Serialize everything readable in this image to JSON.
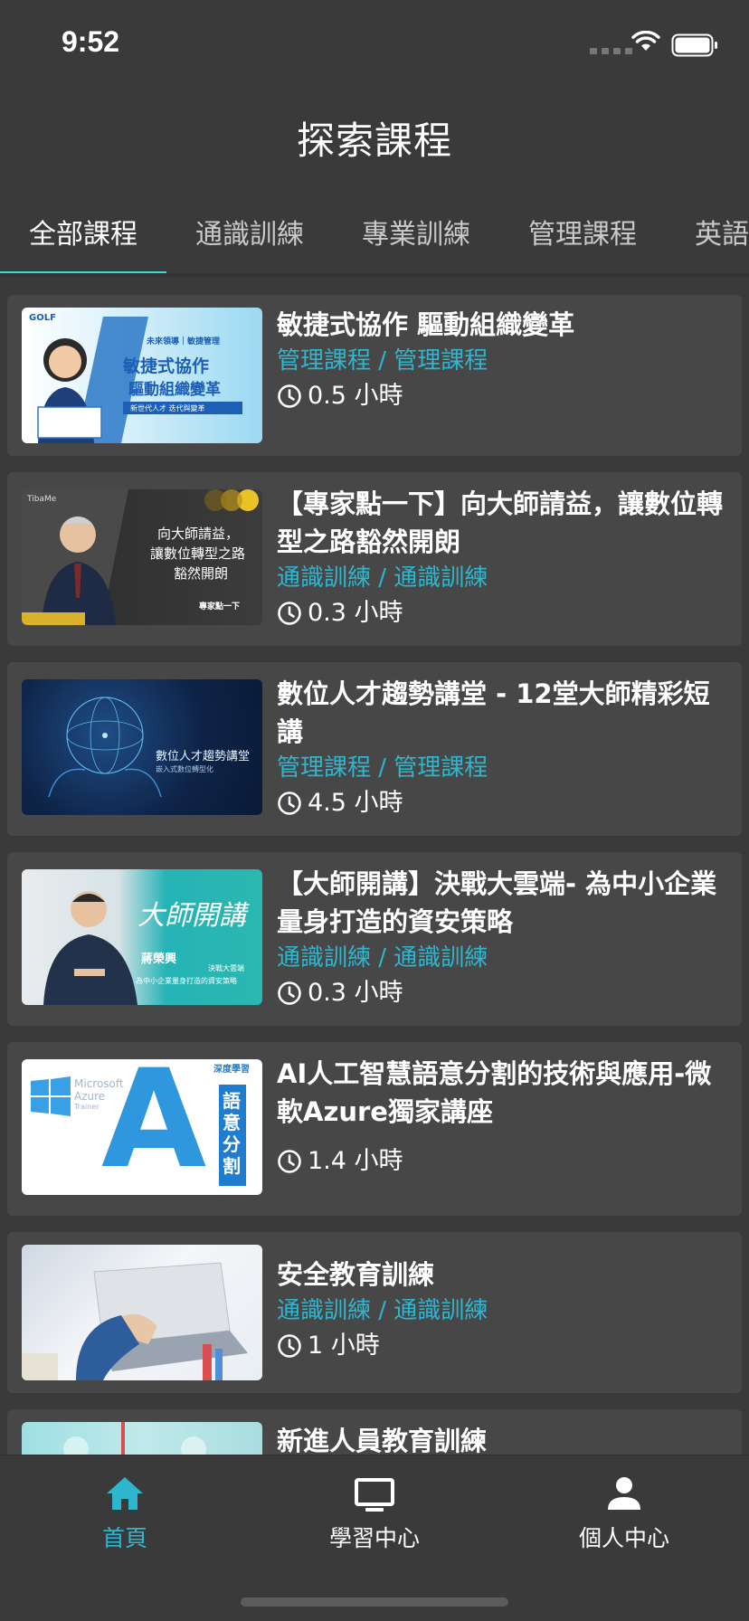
{
  "status": {
    "time": "9:52"
  },
  "header": {
    "title": "探索課程"
  },
  "tabs": [
    {
      "label": "全部課程",
      "active": true
    },
    {
      "label": "通識訓練"
    },
    {
      "label": "專業訓練"
    },
    {
      "label": "管理課程"
    },
    {
      "label": "英語"
    }
  ],
  "courses": [
    {
      "title": "敏捷式協作 驅動組織變革",
      "category": "管理課程 / 管理課程",
      "duration": "0.5 小時",
      "thumb_text": {
        "tag": "未來領導｜敏捷管理",
        "brand": "GOLF",
        "line1": "敏捷式協作",
        "line2": "驅動組織變革",
        "banner": "新世代人才 迭代與變革"
      }
    },
    {
      "title": "【專家點一下】向大師請益，讓數位轉型之路豁然開朗",
      "category": "通識訓練 / 通識訓練",
      "duration": "0.3 小時",
      "thumb_text": {
        "brand": "TibaMe",
        "line1": "向大師請益，",
        "line2": "讓數位轉型之路",
        "line3": "豁然開朗",
        "badge": "專家點一下"
      }
    },
    {
      "title": "數位人才趨勢講堂 - 12堂大師精彩短講",
      "category": "管理課程 / 管理課程",
      "duration": "4.5 小時",
      "thumb_text": {
        "line1": "數位人才趨勢講堂",
        "line2": "嵌入式數位轉型化"
      }
    },
    {
      "title": "【大師開講】決戰大雲端- 為中小企業量身打造的資安策略",
      "category": "通識訓練 / 通識訓練",
      "duration": "0.3 小時",
      "thumb_text": {
        "brand": "大師開講",
        "name": "蔣榮興",
        "line1": "決戰大雲端",
        "line2": "為中小企業量身打造的資安策略"
      }
    },
    {
      "title": "AI人工智慧語意分割的技術與應用-微軟Azure獨家講座",
      "category": "",
      "duration": "1.4 小時",
      "thumb_text": {
        "ms": "Microsoft",
        "azure": "Azure",
        "trainer": "Trainer",
        "big": "A",
        "tag": "深度學習",
        "vert": "語意分割"
      }
    },
    {
      "title": "安全教育訓練",
      "category": "通識訓練 / 通識訓練",
      "duration": "1 小時",
      "thumb_text": {}
    },
    {
      "title": "新進人員教育訓練",
      "category": "",
      "duration": "",
      "thumb_text": {}
    }
  ],
  "bottom_nav": [
    {
      "label": "首頁",
      "icon": "home-icon",
      "active": true
    },
    {
      "label": "學習中心",
      "icon": "monitor-icon"
    },
    {
      "label": "個人中心",
      "icon": "person-icon"
    }
  ],
  "colors": {
    "accent": "#2fb6cf",
    "indicator": "#3ddbd0",
    "background": "#3a3a3a",
    "card": "#474747"
  }
}
